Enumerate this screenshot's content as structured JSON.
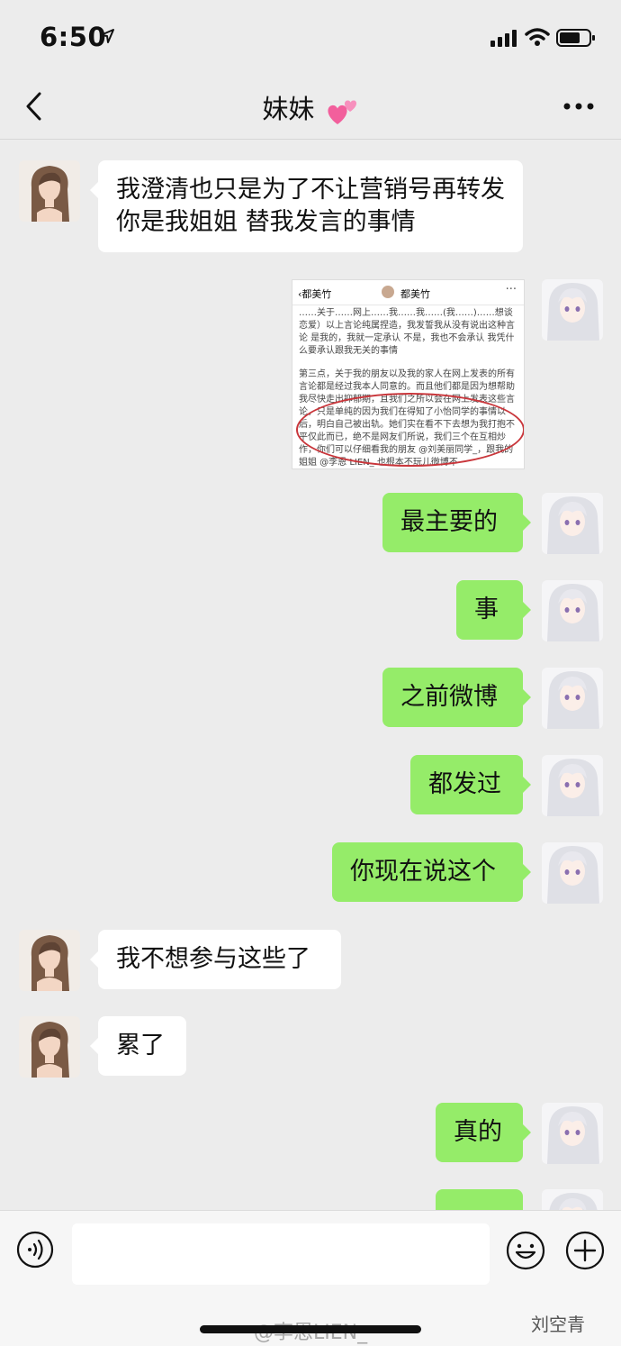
{
  "status_bar": {
    "time": "6:50"
  },
  "nav": {
    "title": "妹妹"
  },
  "messages": [
    {
      "side": "in",
      "text": "我澄清也只是为了不让营销号再转发你是我姐姐 替我发言的事情"
    },
    {
      "side": "out",
      "type": "image"
    },
    {
      "side": "out",
      "text": "最主要的"
    },
    {
      "side": "out",
      "text": "事"
    },
    {
      "side": "out",
      "text": "之前微博"
    },
    {
      "side": "out",
      "text": "都发过"
    },
    {
      "side": "out",
      "text": "你现在说这个"
    },
    {
      "side": "in",
      "text": "我不想参与这些了"
    },
    {
      "side": "in",
      "text": "累了"
    },
    {
      "side": "out",
      "text": "真的"
    }
  ],
  "shared_image": {
    "header_back": "都美竹",
    "header_name": "都美竹",
    "paragraph_1": "……关于……网上……我……我……(我……)……想谈恋爱）以上言论纯属捏造，我发誓我从没有说出这种言论 是我的，我就一定承认 不是，我也不会承认 我凭什么要承认跟我无关的事情",
    "paragraph_2": "第三点，关于我的朋友以及我的家人在网上发表的所有言论都是经过我本人同意的。而且他们都是因为想帮助我尽快走出抑郁期，且我们之所以会在网上发表这些言论，只是单纯的因为我们在得知了小怡同学的事情以后，明白自己被出轨。她们实在看不下去想为我打抱不平仅此而已，绝不是网友们所说，我们三个在互相炒作，你们可以仔细看我的朋友 @刘美丽同学_，跟我的姐姐 @李恩 LIEN_ 也根本不玩儿微博不"
  },
  "watermarks": {
    "left": "@李恩LIEN_",
    "right": "刘空青"
  },
  "colors": {
    "outgoing_bubble": "#95ec69",
    "incoming_bubble": "#ffffff",
    "background": "#ececec"
  }
}
